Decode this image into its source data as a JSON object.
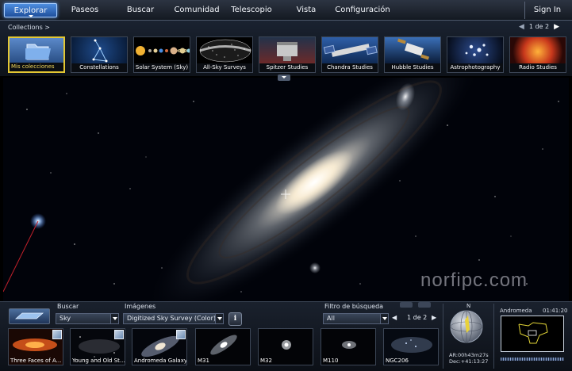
{
  "menu": {
    "items": [
      {
        "label": "Explorar",
        "active": true
      },
      {
        "label": "Paseos"
      },
      {
        "label": "Buscar"
      },
      {
        "label": "Comunidad"
      },
      {
        "label": "Telescopio"
      },
      {
        "label": "Vista"
      },
      {
        "label": "Configuración"
      }
    ],
    "signin": "Sign In"
  },
  "collections": {
    "label": "Collections  >",
    "pager": "1 de 2",
    "items": [
      {
        "label": "Mis colecciones",
        "active": true
      },
      {
        "label": "Constellations"
      },
      {
        "label": "Solar System (Sky)"
      },
      {
        "label": "All-Sky Surveys"
      },
      {
        "label": "Spitzer Studies"
      },
      {
        "label": "Chandra Studies"
      },
      {
        "label": "Hubble Studies"
      },
      {
        "label": "Astrophotography"
      },
      {
        "label": "Radio Studies"
      }
    ]
  },
  "watermark": "norfipc.com",
  "bottom": {
    "buscar_label": "Buscar",
    "buscar_value": "Sky",
    "imagenes_label": "Imágenes",
    "imagenes_value": "Digitized Sky Survey (Color) *",
    "filtro_label": "Filtro de búsqueda",
    "filtro_value": "All",
    "pager": "1 de 2",
    "info_glyph": "i",
    "results": [
      {
        "label": "Three Faces of A...",
        "badge": true
      },
      {
        "label": "Young and Old St...",
        "badge": true
      },
      {
        "label": "Andromeda Galaxy",
        "badge": true
      },
      {
        "label": "M31"
      },
      {
        "label": "M32"
      },
      {
        "label": "M110"
      },
      {
        "label": "NGC206"
      }
    ]
  },
  "minimap": {
    "north": "N",
    "ra": "AR:00h43m27s",
    "dec": "Dec:+41:13:27",
    "constellation": "Andromeda",
    "time": "01:41:20"
  },
  "colors": {
    "accent": "#2f6fcc",
    "selected_border": "#e3c733",
    "background": "#01030a"
  }
}
